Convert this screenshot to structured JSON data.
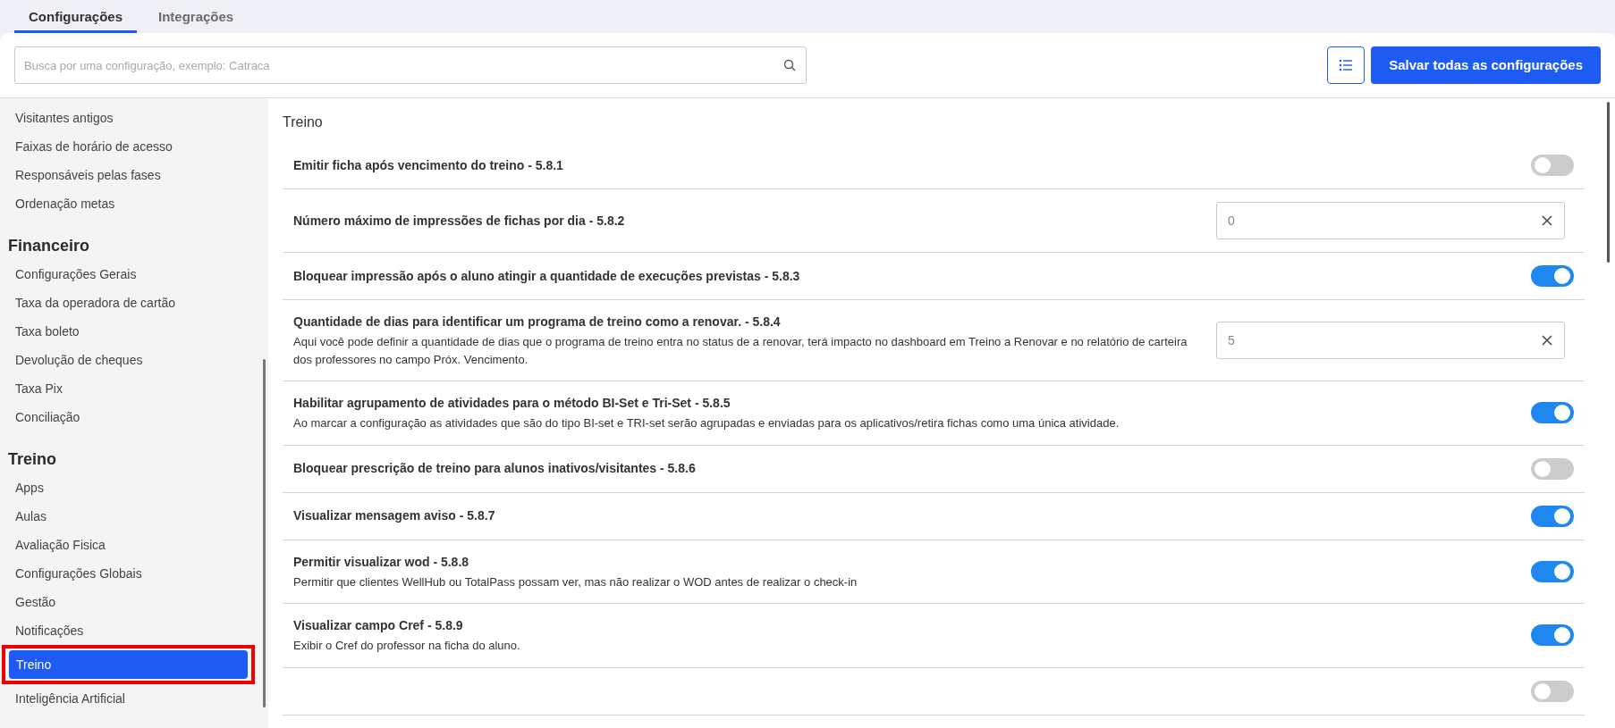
{
  "tabs": [
    {
      "label": "Configurações",
      "selected": true
    },
    {
      "label": "Integrações",
      "selected": false
    }
  ],
  "search": {
    "placeholder": "Busca por uma configuração, exemplo: Catraca"
  },
  "save_button": "Salvar todas as configurações",
  "sidebar": {
    "sections": [
      {
        "items": [
          {
            "label": "Visitantes antigos",
            "selected": false
          },
          {
            "label": "Faixas de horário de acesso",
            "selected": false
          },
          {
            "label": "Responsáveis pelas fases",
            "selected": false
          },
          {
            "label": "Ordenação metas",
            "selected": false
          }
        ]
      },
      {
        "heading": "Financeiro",
        "items": [
          {
            "label": "Configurações Gerais",
            "selected": false
          },
          {
            "label": "Taxa da operadora de cartão",
            "selected": false
          },
          {
            "label": "Taxa boleto",
            "selected": false
          },
          {
            "label": "Devolução de cheques",
            "selected": false
          },
          {
            "label": "Taxa Pix",
            "selected": false
          },
          {
            "label": "Conciliação",
            "selected": false
          }
        ]
      },
      {
        "heading": "Treino",
        "items": [
          {
            "label": "Apps",
            "selected": false
          },
          {
            "label": "Aulas",
            "selected": false
          },
          {
            "label": "Avaliação Fisica",
            "selected": false
          },
          {
            "label": "Configurações Globais",
            "selected": false
          },
          {
            "label": "Gestão",
            "selected": false
          },
          {
            "label": "Notificações",
            "selected": false
          },
          {
            "label": "Treino",
            "selected": true,
            "highlighted": true
          },
          {
            "label": "Inteligência Artificial",
            "selected": false
          }
        ]
      }
    ]
  },
  "section_title": "Treino",
  "settings": [
    {
      "kind": "toggle",
      "title": "Emitir ficha após vencimento do treino - 5.8.1",
      "on": false
    },
    {
      "kind": "number",
      "title": "Número máximo de impressões de fichas por dia - 5.8.2",
      "value": "0"
    },
    {
      "kind": "toggle",
      "title": "Bloquear impressão após o aluno atingir a quantidade de execuções previstas - 5.8.3",
      "on": true
    },
    {
      "kind": "number",
      "title": "Quantidade de dias para identificar um programa de treino como a renovar. - 5.8.4",
      "description": "Aqui você pode definir a quantidade de dias que o programa de treino entra no status de a renovar, terá impacto no dashboard em Treino a Renovar e no relatório de carteira dos professores no campo Próx. Vencimento.",
      "value": "5"
    },
    {
      "kind": "toggle",
      "title": "Habilitar agrupamento de atividades para o método BI-Set e Tri-Set - 5.8.5",
      "description": "Ao marcar a configuração as atividades que são do tipo BI-set e TRI-set serão agrupadas e enviadas para os aplicativos/retira fichas como uma única atividade.",
      "on": true
    },
    {
      "kind": "toggle",
      "title": "Bloquear prescrição de treino para alunos inativos/visitantes - 5.8.6",
      "on": false
    },
    {
      "kind": "toggle",
      "title": "Visualizar mensagem aviso - 5.8.7",
      "on": true
    },
    {
      "kind": "toggle",
      "title": "Permitir visualizar wod - 5.8.8",
      "description": "Permitir que clientes WellHub ou TotalPass possam ver, mas não realizar o WOD antes de realizar o check-in",
      "on": true
    },
    {
      "kind": "toggle",
      "title": "Visualizar campo Cref - 5.8.9",
      "description": "Exibir o Cref do professor na ficha do aluno.",
      "on": true
    },
    {
      "kind": "toggle",
      "on": false
    }
  ]
}
